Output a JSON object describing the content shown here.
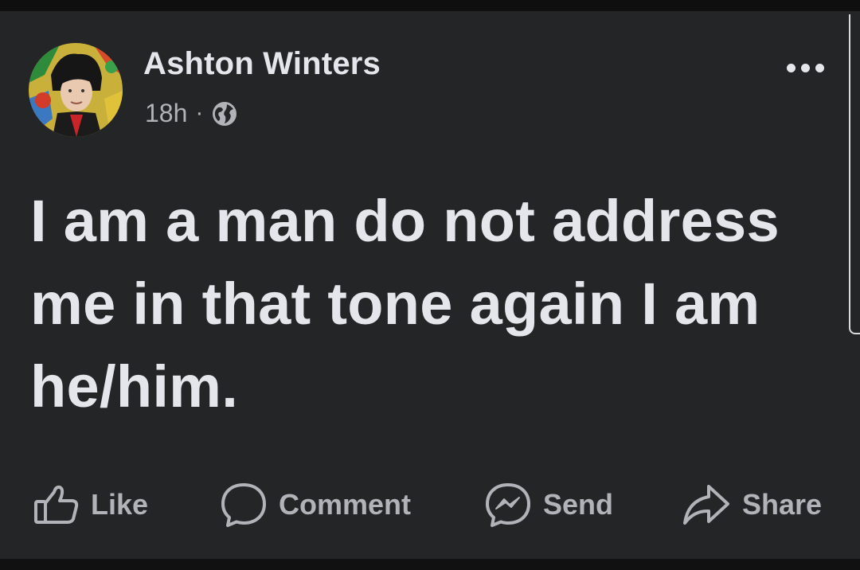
{
  "post": {
    "author": "Ashton Winters",
    "time": "18h",
    "separator": "·",
    "privacy_icon": "globe-icon",
    "more_icon": "more-options-icon",
    "text": "I am a man do not address me in that tone again I am he/him."
  },
  "actions": {
    "like": {
      "label": "Like",
      "icon": "thumbs-up-icon"
    },
    "comment": {
      "label": "Comment",
      "icon": "comment-bubble-icon"
    },
    "send": {
      "label": "Send",
      "icon": "messenger-icon"
    },
    "share": {
      "label": "Share",
      "icon": "share-arrow-icon"
    }
  },
  "colors": {
    "background": "#242526",
    "primary_text": "#e4e6eb",
    "secondary_text": "#b0b3b8"
  }
}
